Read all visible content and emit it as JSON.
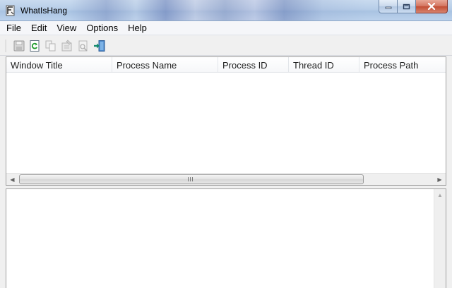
{
  "window": {
    "title": "WhatIsHang",
    "icon": "whatishang-app-icon"
  },
  "caption_buttons": [
    "minimize-icon",
    "maximize-icon",
    "close-icon"
  ],
  "menu": [
    {
      "label": "File"
    },
    {
      "label": "Edit"
    },
    {
      "label": "View"
    },
    {
      "label": "Options"
    },
    {
      "label": "Help"
    }
  ],
  "toolbar": [
    {
      "icon": "save-icon",
      "enabled": false
    },
    {
      "icon": "refresh-icon",
      "enabled": true
    },
    {
      "icon": "copy-icon",
      "enabled": false
    },
    {
      "icon": "properties-icon",
      "enabled": false
    },
    {
      "icon": "html-report-icon",
      "enabled": false
    },
    {
      "icon": "exit-icon",
      "enabled": true
    }
  ],
  "list": {
    "columns": [
      {
        "label": "Window Title"
      },
      {
        "label": "Process Name"
      },
      {
        "label": "Process ID"
      },
      {
        "label": "Thread ID"
      },
      {
        "label": "Process Path"
      }
    ],
    "rows": []
  },
  "colors": {
    "titlebar": "#b7cde8",
    "close_button": "#c24d33",
    "window_bg": "#f0f0f0"
  }
}
